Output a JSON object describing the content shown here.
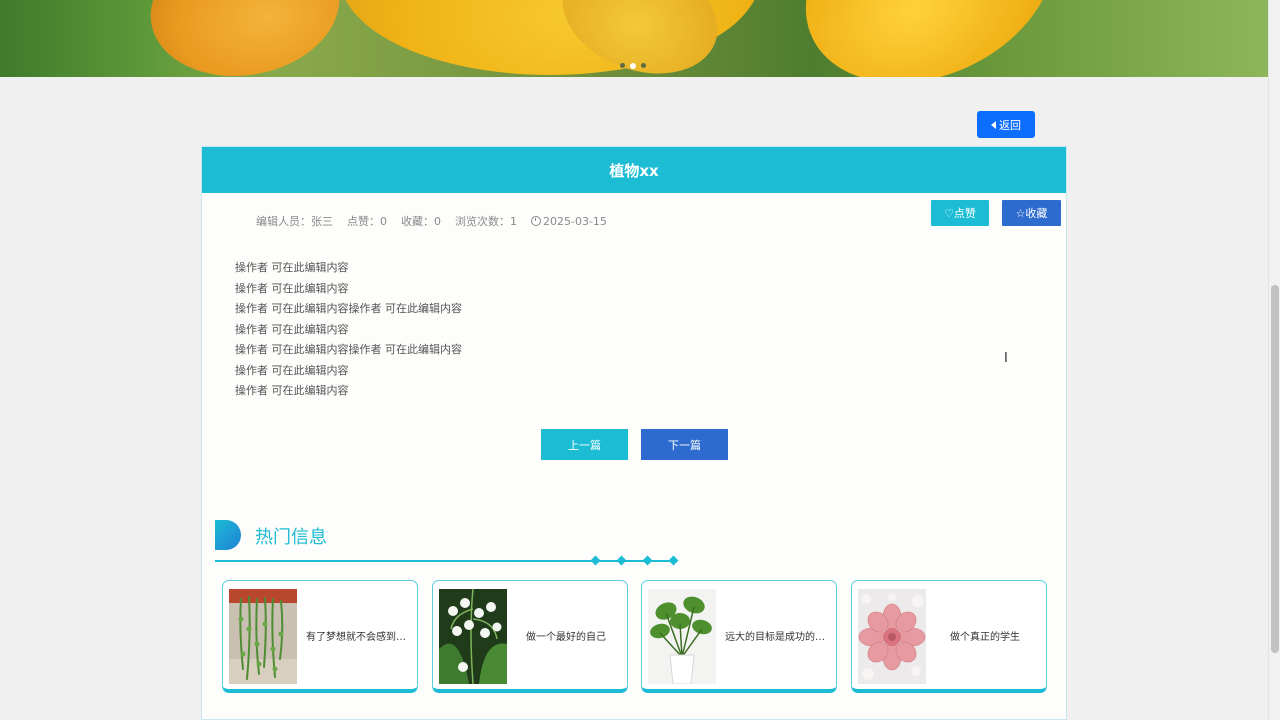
{
  "banner": {
    "slides_total": 3,
    "active_slide": 2
  },
  "back_label": "返回",
  "article": {
    "title": "植物xx",
    "meta": {
      "editor": "编辑人员：张三",
      "likes": "点赞：0",
      "favorites": "收藏：0",
      "views": "浏览次数：1",
      "date": "2025-03-15"
    },
    "like_label": "♡点赞",
    "favorite_label": "☆收藏",
    "content_lines": [
      "操作者  可在此编辑内容",
      "操作者  可在此编辑内容",
      "操作者  可在此编辑内容操作者  可在此编辑内容",
      "操作者  可在此编辑内容",
      "操作者  可在此编辑内容操作者  可在此编辑内容",
      "操作者  可在此编辑内容",
      "操作者  可在此编辑内容"
    ],
    "prev_label": "上一篇",
    "next_label": "下一篇"
  },
  "hot": {
    "title": "热门信息",
    "cards": [
      {
        "text": "有了梦想就不会感到…",
        "icon": "hanging-plant-image"
      },
      {
        "text": "做一个最好的自己",
        "icon": "lily-of-the-valley-image"
      },
      {
        "text": "远大的目标是成功的…",
        "icon": "potted-plant-image"
      },
      {
        "text": "做个真正的学生",
        "icon": "succulent-image"
      }
    ]
  },
  "colors": {
    "teal": "#1cbcd4",
    "blue": "#2d6bcf",
    "back": "#0d6efd"
  }
}
